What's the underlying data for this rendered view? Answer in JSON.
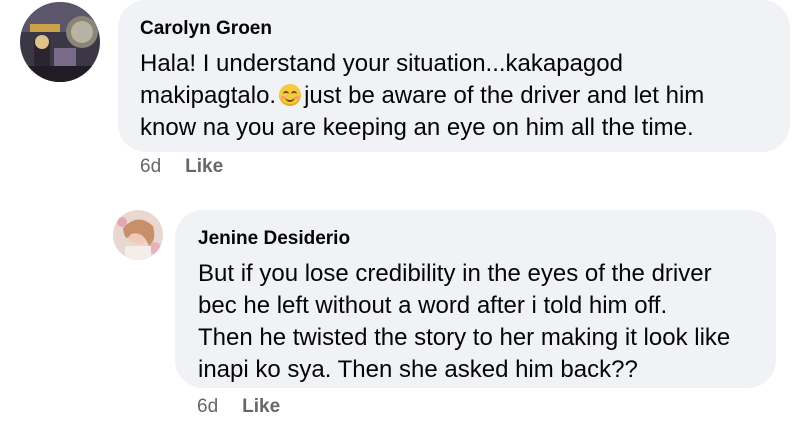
{
  "comments": [
    {
      "author": "Carolyn Groen",
      "lines": [
        "Hala! I understand your situation...kakapagod",
        "makipagtalo.",
        "just be aware of the driver and let him",
        "know na you are keeping an eye on him all the time."
      ],
      "emoji": "smiling-face-emoji",
      "time": "6d",
      "like_label": "Like"
    },
    {
      "author": "Jenine Desiderio",
      "lines": [
        "But if you lose credibility in the eyes of the driver",
        "bec he left without a word after i told him off.",
        "Then he twisted the story to her making it look like",
        "inapi ko sya. Then she asked him back??"
      ],
      "time": "6d",
      "like_label": "Like"
    }
  ],
  "colors": {
    "bubble": "#f0f2f5",
    "meta_text": "#65676b",
    "text": "#050505"
  }
}
